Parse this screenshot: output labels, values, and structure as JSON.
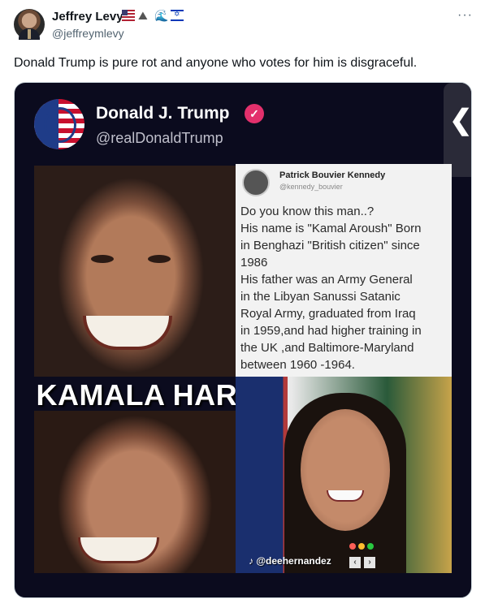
{
  "author": {
    "name": "Jeffrey Levy",
    "handle": "@jeffreymlevy",
    "badge_icons": [
      "us-flag-icon",
      "mountain-icon",
      "wave-icon",
      "israel-flag-icon"
    ]
  },
  "more_icon": "more-icon",
  "tweet": {
    "text": "Donald Trump is pure rot and anyone who votes for him is disgraceful."
  },
  "media": {
    "inner_post": {
      "name": "Donald J. Trump",
      "handle": "@realDonaldTrump"
    },
    "screenshot": {
      "name": "Patrick Bouvier Kennedy",
      "handle": "@kennedy_bouvier",
      "lines": [
        "Do you know this man..?",
        "His name is \"Kamal Aroush\" Born",
        "in Benghazi \"British citizen\" since",
        "1986",
        "His father was an Army General",
        "in the Libyan Sanussi Satanic",
        "Royal Army, graduated from Iraq",
        "in 1959,and had higher training in",
        "the UK ,and Baltimore-Maryland",
        "between 1960 -1964."
      ]
    },
    "headline": "KAMALA HARRIS IS A MAN",
    "credit": "@deehernandez",
    "side_tab": "❮"
  },
  "colors": {
    "verified": "#e3306c",
    "media_bg": "#0b0b1e"
  }
}
